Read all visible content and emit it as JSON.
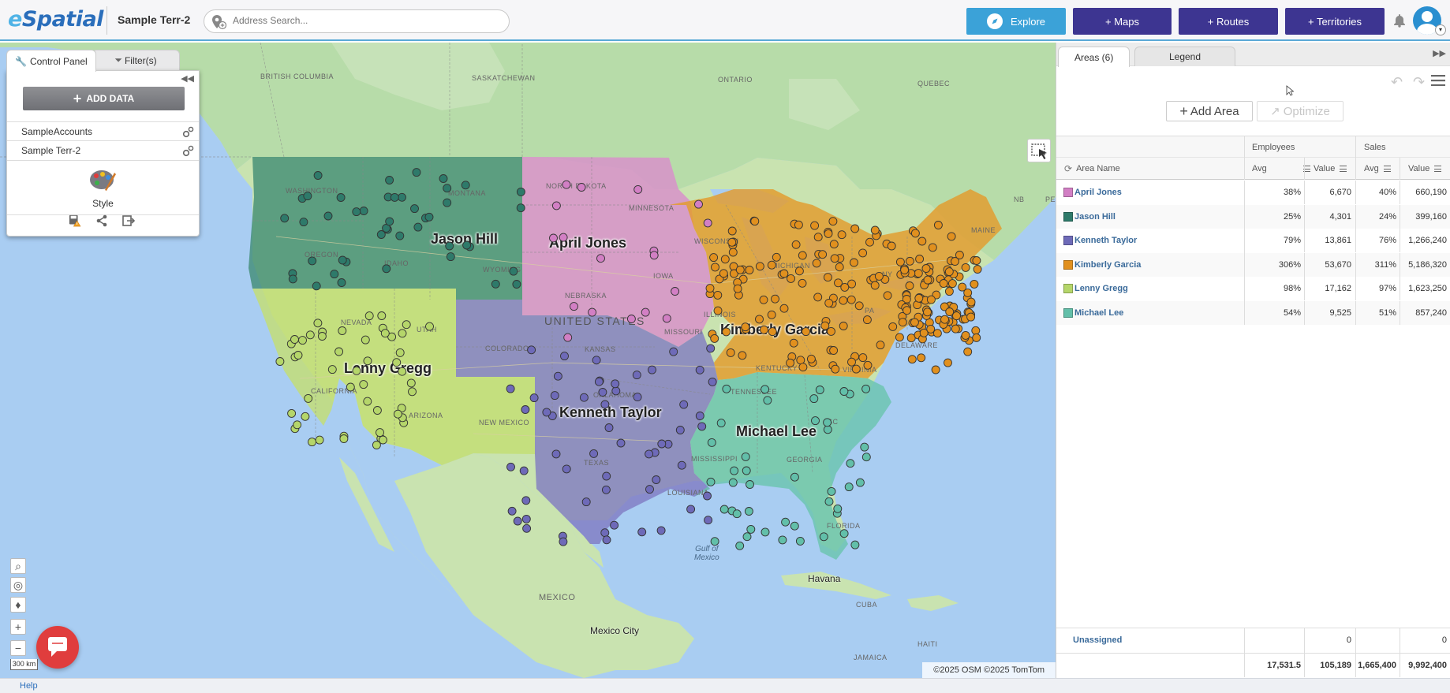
{
  "app": {
    "logo": "eSpatial",
    "map_name": "Sample Terr-2",
    "search_placeholder": "Address Search..."
  },
  "nav": {
    "explore": "Explore",
    "maps": "+ Maps",
    "routes": "+ Routes",
    "territories": "+ Territories"
  },
  "control_panel": {
    "tab_control": "Control Panel",
    "tab_filters": "Filter(s)",
    "add_data": "ADD DATA",
    "layers": [
      "SampleAccounts",
      "Sample Terr-2"
    ],
    "style_label": "Style"
  },
  "map": {
    "territory_labels": [
      "Jason Hill",
      "April Jones",
      "Kimberly Garcia",
      "Lenny Gregg",
      "Kenneth Taylor",
      "Michael Lee"
    ],
    "region_labels": [
      "BRITISH COLUMBIA",
      "SASKATCHEWAN",
      "ONTARIO",
      "QUEBEC",
      "WASHINGTON",
      "MONTANA",
      "NORTH DAKOTA",
      "MINNESOTA",
      "OREGON",
      "IDAHO",
      "WYOMING",
      "NEBRASKA",
      "IOWA",
      "NEVADA",
      "UTAH",
      "COLORADO",
      "KANSAS",
      "MISSOURI",
      "ILLINOIS",
      "CALIFORNIA",
      "ARIZONA",
      "NEW MEXICO",
      "OKLAHOMA",
      "TEXAS",
      "KENTUCKY",
      "VIRGINIA",
      "TENNESSEE",
      "MISSISSIPPI",
      "GEORGIA",
      "FLORIDA",
      "LOUISIANA",
      "MAINE",
      "NY",
      "PA",
      "SC",
      "NB",
      "PE",
      "DELAWARE",
      "WISCONSIN",
      "MICHIGAN",
      "UNITED STATES",
      "MEXICO",
      "CUBA",
      "HAITI",
      "JAMAICA"
    ],
    "cities": [
      "Havana",
      "Mexico City"
    ],
    "water": "Gulf of\nMexico",
    "attribution": "©2025 OSM ©2025 TomTom",
    "scale": "300 km"
  },
  "right_panel": {
    "tab_areas": "Areas (6)",
    "tab_legend": "Legend",
    "add_area": "Add Area",
    "optimize": "Optimize",
    "group_employees": "Employees",
    "group_sales": "Sales",
    "col_area_name": "Area Name",
    "col_avg": "Avg",
    "col_value": "Value",
    "rows": [
      {
        "name": "April Jones",
        "color": "#d27fc4",
        "emp_avg": "38%",
        "emp_val": "6,670",
        "sales_avg": "40%",
        "sales_val": "660,190"
      },
      {
        "name": "Jason Hill",
        "color": "#2e7a6a",
        "emp_avg": "25%",
        "emp_val": "4,301",
        "sales_avg": "24%",
        "sales_val": "399,160"
      },
      {
        "name": "Kenneth Taylor",
        "color": "#6e6ab8",
        "emp_avg": "79%",
        "emp_val": "13,861",
        "sales_avg": "76%",
        "sales_val": "1,266,240"
      },
      {
        "name": "Kimberly Garcia",
        "color": "#e1901e",
        "emp_avg": "306%",
        "emp_val": "53,670",
        "sales_avg": "311%",
        "sales_val": "5,186,320"
      },
      {
        "name": "Lenny Gregg",
        "color": "#b5d66a",
        "emp_avg": "98%",
        "emp_val": "17,162",
        "sales_avg": "97%",
        "sales_val": "1,623,250"
      },
      {
        "name": "Michael Lee",
        "color": "#62bfa9",
        "emp_avg": "54%",
        "emp_val": "9,525",
        "sales_avg": "51%",
        "sales_val": "857,240"
      }
    ],
    "unassigned_label": "Unassigned",
    "unassigned_emp": "0",
    "unassigned_sales": "0",
    "totals": {
      "emp_avg": "17,531.5",
      "emp_val": "105,189",
      "sales_avg": "1,665,400",
      "sales_val": "9,992,400"
    }
  },
  "footer": {
    "help": "Help"
  }
}
